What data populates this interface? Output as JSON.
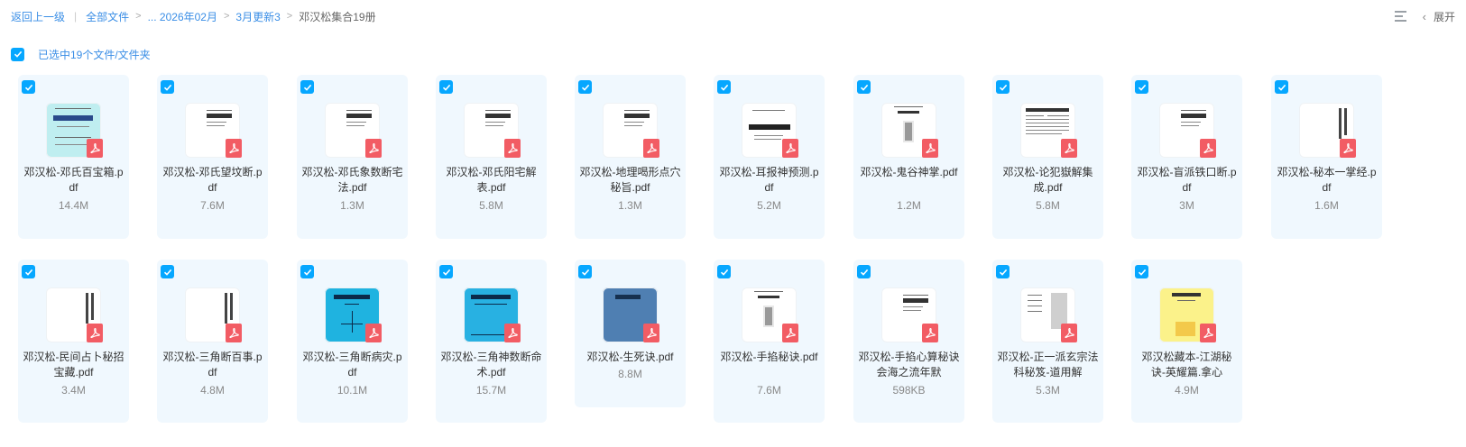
{
  "breadcrumb": {
    "back": "返回上一级",
    "all_files": "全部文件",
    "ellipsis_path": "... 2026年02月",
    "folder": "3月更新3",
    "current": "邓汉松集合19册"
  },
  "toolbar": {
    "expand_label": "展开"
  },
  "selection": {
    "text": "已选中19个文件/文件夹"
  },
  "files": [
    {
      "name": "邓汉松-邓氏百宝箱.pdf",
      "size": "14.4M",
      "thumb": "cyan-cover"
    },
    {
      "name": "邓汉松-邓氏望坟断.pdf",
      "size": "7.6M",
      "thumb": "text-page"
    },
    {
      "name": "邓汉松-邓氏象数断宅法.pdf",
      "size": "1.3M",
      "thumb": "text-page"
    },
    {
      "name": "邓汉松-邓氏阳宅解表.pdf",
      "size": "5.8M",
      "thumb": "text-page"
    },
    {
      "name": "邓汉松-地理喝形点穴秘旨.pdf",
      "size": "1.3M",
      "thumb": "text-page"
    },
    {
      "name": "邓汉松-耳报神预测.pdf",
      "size": "5.2M",
      "thumb": "bold-title"
    },
    {
      "name": "邓汉松-鬼谷神掌.pdf",
      "size": "1.2M",
      "thumb": "hand-page"
    },
    {
      "name": "邓汉松-论犯嶽解集成.pdf",
      "size": "5.8M",
      "thumb": "dense-page"
    },
    {
      "name": "邓汉松-盲派铁口断.pdf",
      "size": "3M",
      "thumb": "text-page"
    },
    {
      "name": "邓汉松-秘本一掌经.pdf",
      "size": "1.6M",
      "thumb": "vertical-text"
    },
    {
      "name": "邓汉松-民间占卜秘招宝藏.pdf",
      "size": "3.4M",
      "thumb": "vertical-text"
    },
    {
      "name": "邓汉松-三角断百事.pdf",
      "size": "4.8M",
      "thumb": "vertical-text"
    },
    {
      "name": "邓汉松-三角断病灾.pdf",
      "size": "10.1M",
      "thumb": "blue-triangle"
    },
    {
      "name": "邓汉松-三角神数断命术.pdf",
      "size": "15.7M",
      "thumb": "blue-cover"
    },
    {
      "name": "邓汉松-生死诀.pdf",
      "size": "8.8M",
      "thumb": "slate-cover"
    },
    {
      "name": "邓汉松-手掐秘诀.pdf",
      "size": "7.6M",
      "thumb": "hand-page"
    },
    {
      "name": "邓汉松-手掐心算秘诀会海之流年默",
      "size": "598KB",
      "thumb": "text-page"
    },
    {
      "name": "邓汉松-正一派玄宗法科秘笈-道用解",
      "size": "5.3M",
      "thumb": "figure-page"
    },
    {
      "name": "邓汉松藏本-江湖秘诀-英耀篇.拿心",
      "size": "4.9M",
      "thumb": "yellow-cover"
    }
  ],
  "colors": {
    "accent": "#06a7ff",
    "card_bg": "#f0f8fe",
    "pdf_badge": "#f25c64",
    "link": "#3a8ee6"
  },
  "icons": {
    "checkbox": "checkbox-checked-icon",
    "pdf": "pdf-file-icon",
    "list_view": "list-view-icon",
    "chevron": "chevron-left-icon"
  }
}
